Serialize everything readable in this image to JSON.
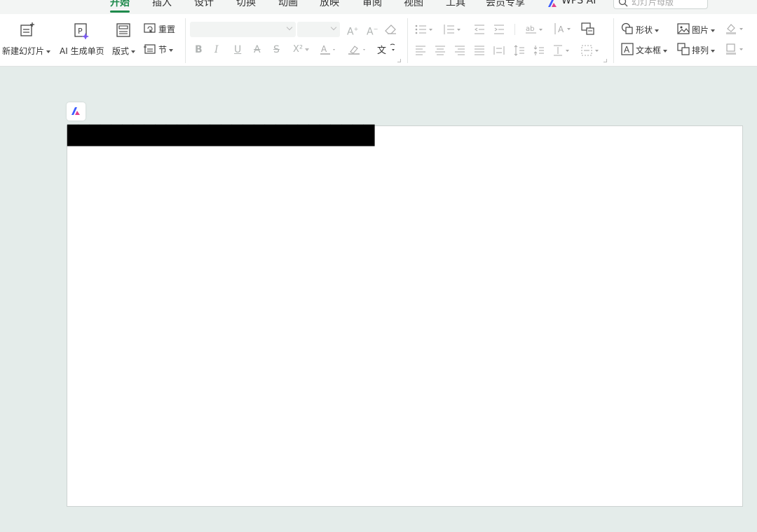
{
  "tabs": [
    {
      "label": "开始",
      "active": true
    },
    {
      "label": "插入"
    },
    {
      "label": "设计"
    },
    {
      "label": "切换"
    },
    {
      "label": "动画"
    },
    {
      "label": "放映"
    },
    {
      "label": "审阅"
    },
    {
      "label": "视图"
    },
    {
      "label": "工具"
    },
    {
      "label": "会员专享"
    },
    {
      "label": "WPS AI"
    }
  ],
  "search": {
    "placeholder": "幻灯片母版"
  },
  "ribbon": {
    "new_slide": "新建幻灯片",
    "ai_single_page": "AI 生成单页",
    "layout": "版式",
    "reset": "重置",
    "section": "节",
    "bold": "B",
    "italic": "I",
    "underline": "U",
    "strikethrough": "A",
    "shadow": "S",
    "superscript": "X²",
    "shape": "形状",
    "picture": "图片",
    "textbox": "文本框",
    "arrange": "排列"
  },
  "slide": {
    "title_text": "████████████████████████████"
  },
  "colors": {
    "accent": "#1f8a4c",
    "background": "#e4ecea",
    "ribbon": "#ffffff"
  }
}
